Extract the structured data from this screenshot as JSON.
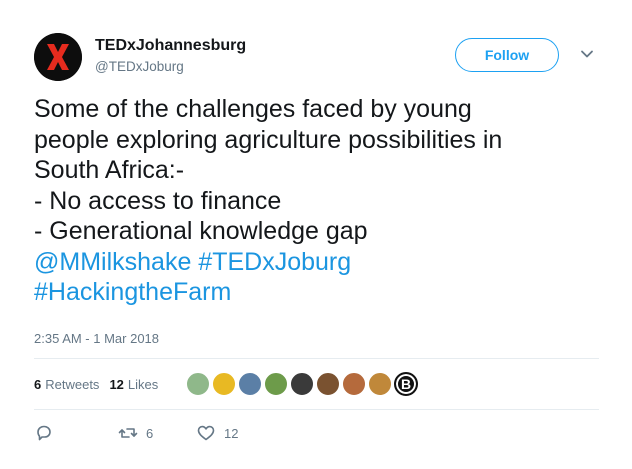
{
  "account": {
    "name": "TEDxJohannesburg",
    "handle": "@TEDxJoburg",
    "avatar_icon": "tedx-x-logo"
  },
  "follow_label": "Follow",
  "tweet": {
    "lines": [
      "Some of the challenges faced by young",
      "people exploring agriculture possibilities in",
      "South Africa:-",
      "- No access to finance",
      "- Generational knowledge gap"
    ],
    "mention": "@MMilkshake",
    "hashtags": [
      "#TEDxJoburg",
      "#HackingtheFarm"
    ]
  },
  "timestamp": "2:35 AM - 1 Mar 2018",
  "stats": {
    "retweets_count": "6",
    "retweets_label": "Retweets",
    "likes_count": "12",
    "likes_label": "Likes"
  },
  "actions": {
    "reply_icon": "reply-icon",
    "retweet_count": "6",
    "like_count": "12"
  },
  "colors": {
    "accent": "#1da1f2",
    "link": "#1b95e0",
    "muted": "#657786",
    "text": "#14171a"
  },
  "likers": [
    {
      "label": "liker-avatar-1",
      "color": "#8fb88a"
    },
    {
      "label": "liker-avatar-2",
      "color": "#e8b923"
    },
    {
      "label": "liker-avatar-3",
      "color": "#5b7fa6"
    },
    {
      "label": "liker-avatar-4",
      "color": "#6d9b4a"
    },
    {
      "label": "liker-avatar-5",
      "color": "#3a3a3a"
    },
    {
      "label": "liker-avatar-6",
      "color": "#7a5230"
    },
    {
      "label": "liker-avatar-7",
      "color": "#b56a3c"
    },
    {
      "label": "liker-avatar-8",
      "color": "#c0883a"
    },
    {
      "label": "liker-avatar-9",
      "color": "#111111",
      "letter": "B"
    }
  ]
}
